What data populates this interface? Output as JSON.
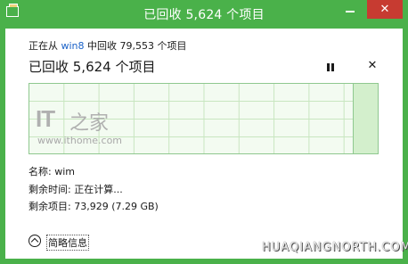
{
  "window": {
    "title": "已回收 5,624 个项目",
    "close_label": "✕",
    "title_color": "#4ab14a",
    "close_color": "#c73b31"
  },
  "operation": {
    "from_prefix": "正在从",
    "from_source": "win8",
    "from_suffix": "中回收 79,553 个项目",
    "headline": "已回收 5,624 个项目",
    "pause_icon": "pause-icon",
    "cancel_label": "✕",
    "progress_fraction": 0.07
  },
  "watermark": {
    "logo_text": "IT",
    "logo_char": "之家",
    "url": "www.ithome.com"
  },
  "details": {
    "name": "名称: wim",
    "time_remaining": "剩余时间: 正在计算...",
    "items_remaining": "剩余项目: 73,929 (7.29 GB)"
  },
  "toggle": {
    "label": "简略信息"
  },
  "footer_watermark": "HUAQIANGNORTH.COM"
}
